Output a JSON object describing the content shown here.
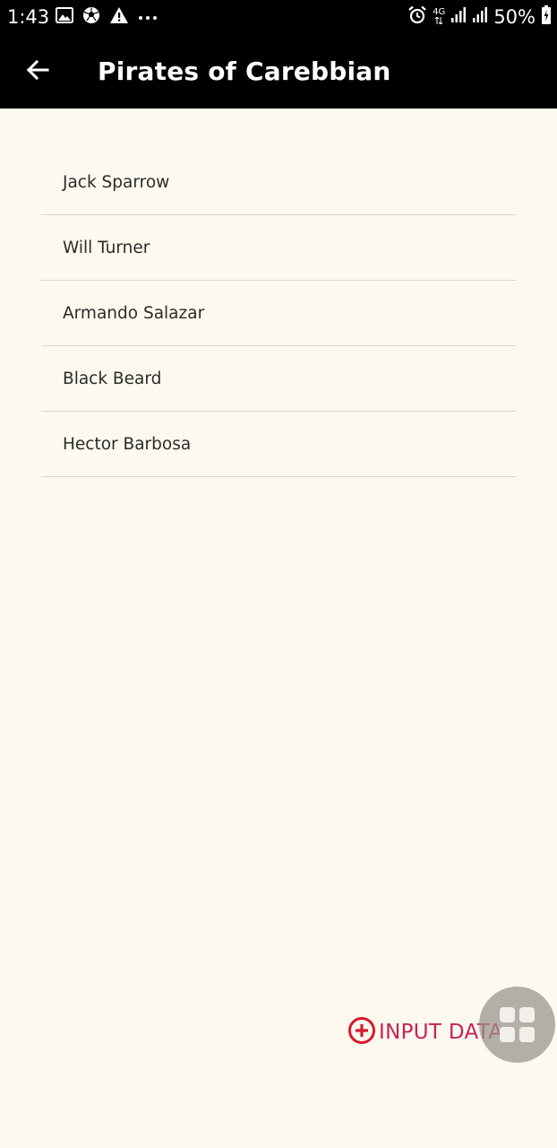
{
  "status_bar": {
    "time": "1:43",
    "battery_text": "50%",
    "network_label": "4G",
    "left_icons": [
      "image-icon",
      "soccer-ball-icon",
      "warning-icon",
      "more-dots-icon"
    ],
    "right_icons": [
      "alarm-icon",
      "network-4g-icon",
      "signal-icon",
      "signal-icon",
      "battery-charging-icon"
    ]
  },
  "app_bar": {
    "title": "Pirates of Carebbian",
    "back_icon": "arrow-left-icon"
  },
  "list": {
    "items": [
      {
        "label": "Jack Sparrow"
      },
      {
        "label": "Will Turner"
      },
      {
        "label": "Armando Salazar"
      },
      {
        "label": "Black Beard"
      },
      {
        "label": "Hector Barbosa"
      }
    ]
  },
  "input_button": {
    "label": "INPUT DATA",
    "icon": "plus-circle-icon",
    "color": "#C8205A"
  },
  "fab": {
    "icon": "grid-icon"
  },
  "colors": {
    "background": "#FDF9EE",
    "app_bar": "#000000",
    "divider": "#D8D5CE",
    "accent": "#C8205A",
    "plus_icon": "#D8192E"
  }
}
